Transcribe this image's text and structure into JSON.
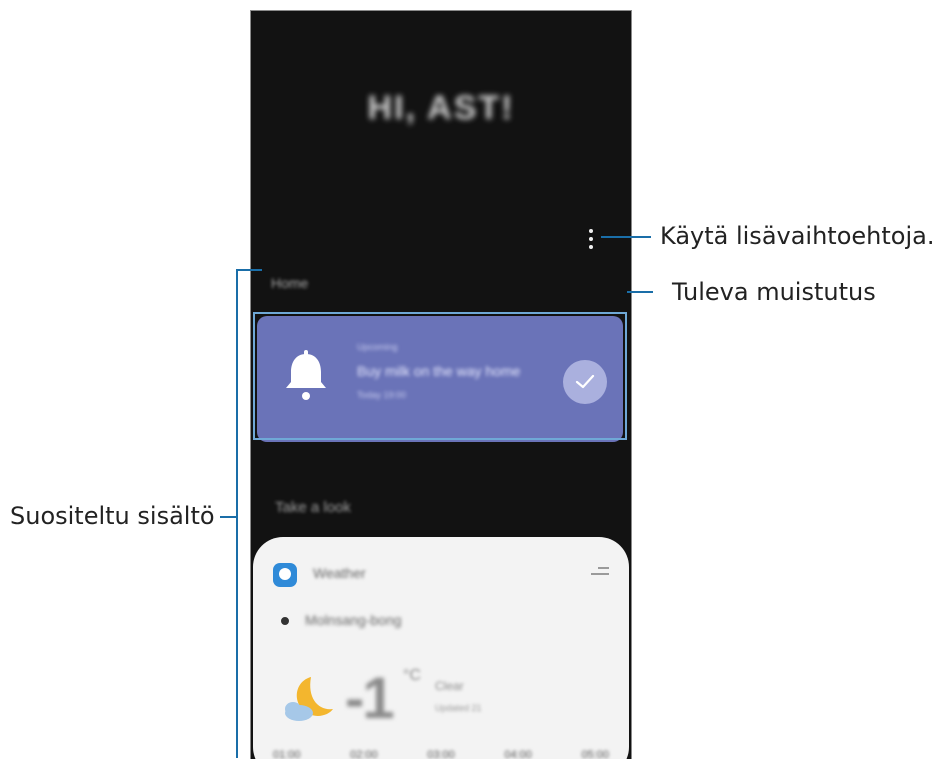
{
  "screen": {
    "greeting": "HI, AST!",
    "home_section_label": "Home",
    "reminder": {
      "small_label": "Upcoming",
      "title": "Buy milk on the way home",
      "time": "Today 19:00"
    },
    "suggested_section_label": "Take a look",
    "weather": {
      "app_name": "Weather",
      "location": "Molnsang-bong",
      "temperature": "-1",
      "unit": "°C",
      "condition": "Clear",
      "updated": "Updated 21",
      "hours": [
        "01:00",
        "02:00",
        "03:00",
        "04:00",
        "05:00"
      ]
    }
  },
  "callouts": {
    "more_options": "Käytä lisävaihtoehtoja.",
    "upcoming_reminder": "Tuleva muistutus",
    "suggested_content": "Suositeltu sisältö"
  },
  "colors": {
    "screen_bg": "#121212",
    "reminder_card": "#6a73b8",
    "callout_line": "#1a6ea8"
  }
}
